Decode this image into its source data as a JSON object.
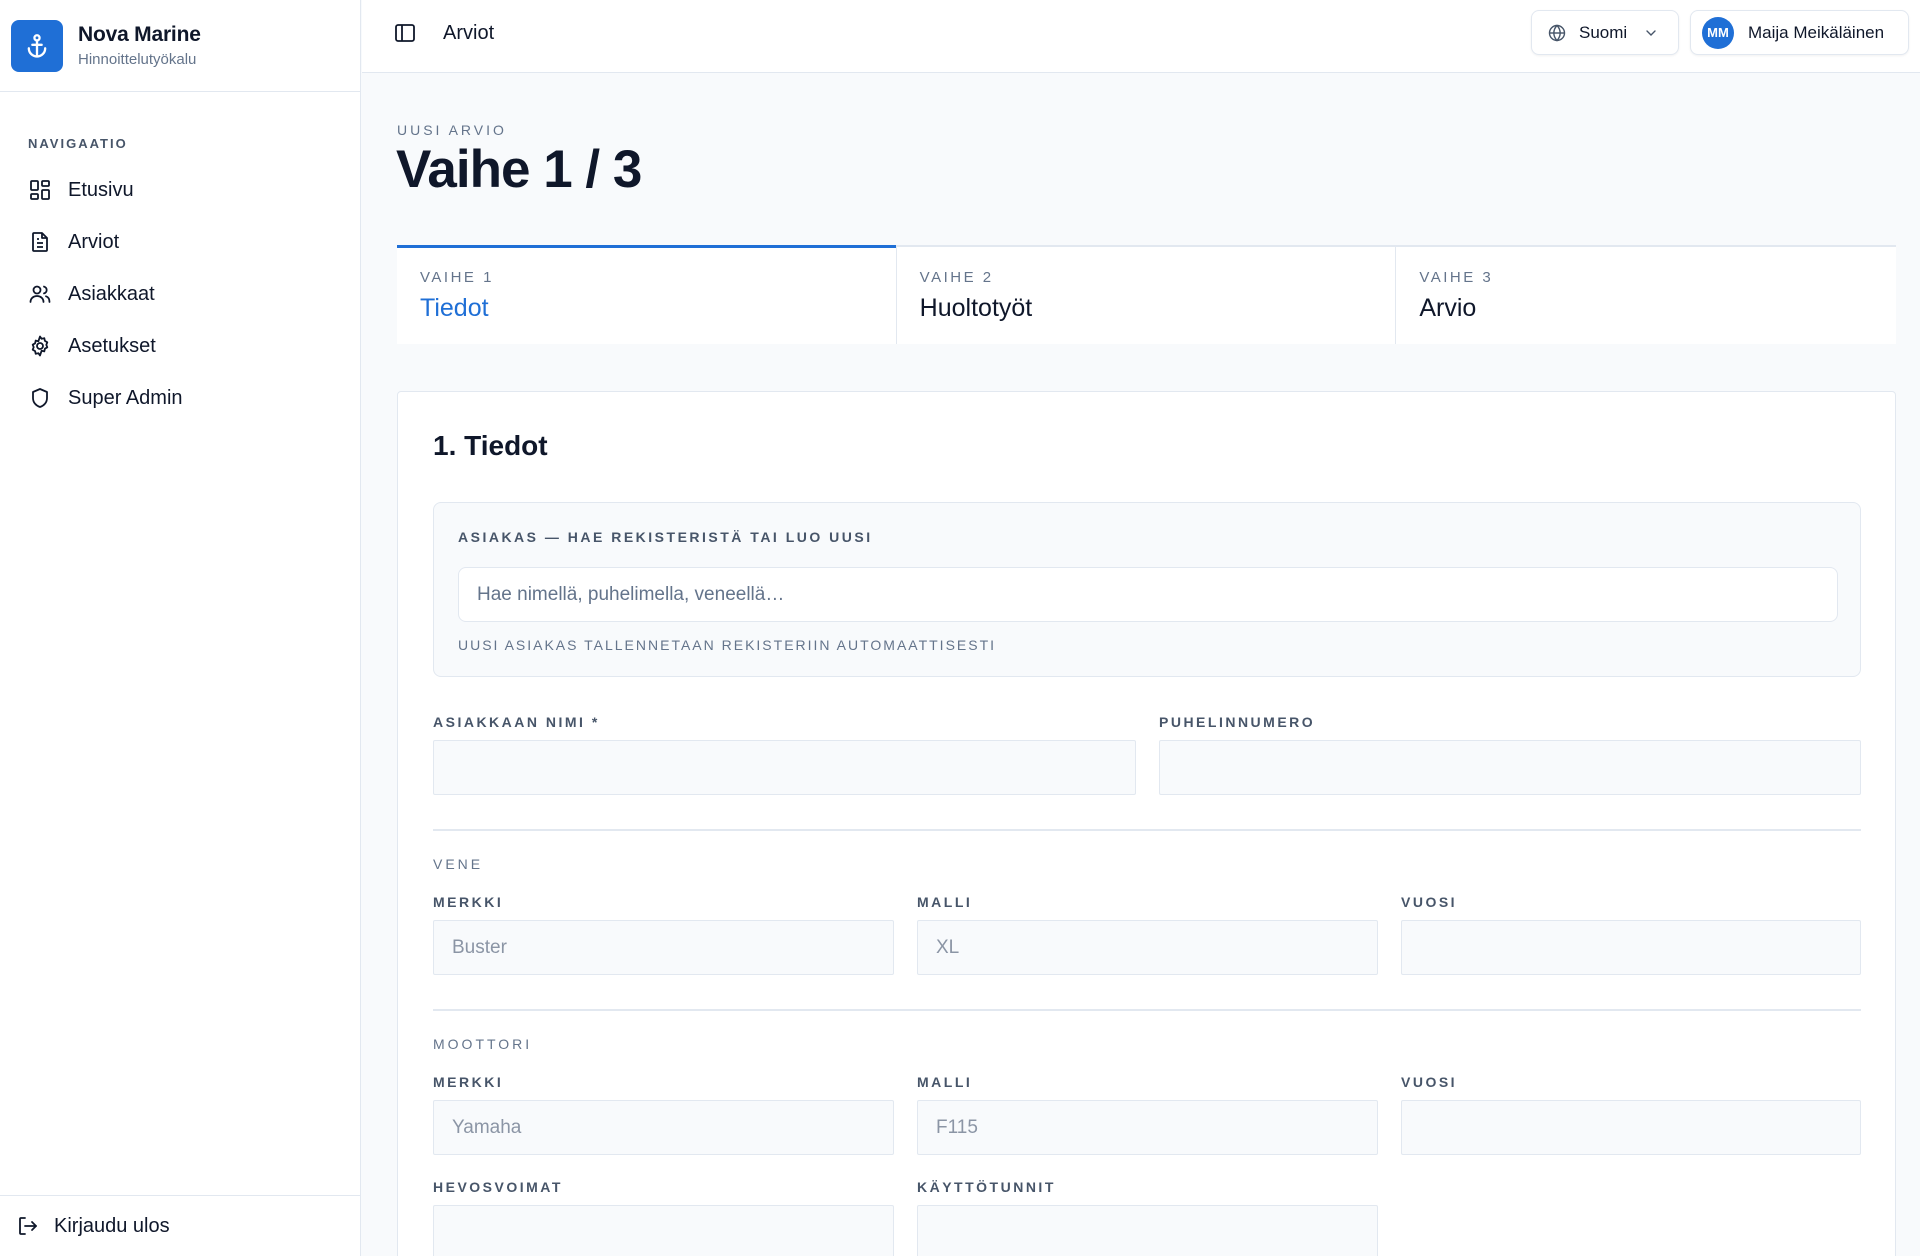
{
  "brand": {
    "name": "Nova Marine",
    "subtitle": "Hinnoittelutyökalu",
    "logo_icon": "anchor-icon"
  },
  "sidebar": {
    "nav_title": "NAVIGAATIO",
    "items": [
      {
        "label": "Etusivu",
        "icon": "dashboard-icon"
      },
      {
        "label": "Arviot",
        "icon": "document-icon"
      },
      {
        "label": "Asiakkaat",
        "icon": "users-icon"
      },
      {
        "label": "Asetukset",
        "icon": "gear-icon"
      },
      {
        "label": "Super Admin",
        "icon": "shield-icon"
      }
    ],
    "logout_label": "Kirjaudu ulos"
  },
  "topbar": {
    "title": "Arviot",
    "language": "Suomi",
    "user": {
      "initials": "MM",
      "name": "Maija Meikäläinen"
    }
  },
  "page": {
    "kicker": "UUSI ARVIO",
    "title": "Vaihe 1 / 3"
  },
  "steps": [
    {
      "label": "VAIHE 1",
      "name": "Tiedot",
      "active": true
    },
    {
      "label": "VAIHE 2",
      "name": "Huoltotyöt",
      "active": false
    },
    {
      "label": "VAIHE 3",
      "name": "Arvio",
      "active": false
    }
  ],
  "form": {
    "title": "1. Tiedot",
    "customer_search": {
      "label": "ASIAKAS — HAE REKISTERISTÄ TAI LUO UUSI",
      "placeholder": "Hae nimellä, puhelimella, veneellä…",
      "hint": "UUSI ASIAKAS TALLENNETAAN REKISTERIIN AUTOMAATTISESTI"
    },
    "customer_name": {
      "label": "ASIAKKAAN NIMI *",
      "value": ""
    },
    "phone": {
      "label": "PUHELINNUMERO",
      "value": ""
    },
    "boat": {
      "section": "VENE",
      "brand": {
        "label": "MERKKI",
        "placeholder": "Buster"
      },
      "model": {
        "label": "MALLI",
        "placeholder": "XL"
      },
      "year": {
        "label": "VUOSI",
        "placeholder": ""
      }
    },
    "engine": {
      "section": "MOOTTORI",
      "brand": {
        "label": "MERKKI",
        "placeholder": "Yamaha"
      },
      "model": {
        "label": "MALLI",
        "placeholder": "F115"
      },
      "year": {
        "label": "VUOSI",
        "placeholder": ""
      },
      "horsepower": {
        "label": "HEVOSVOIMAT",
        "placeholder": ""
      },
      "hours": {
        "label": "KÄYTTÖTUNNIT",
        "placeholder": ""
      }
    }
  },
  "colors": {
    "accent": "#1f6fd6",
    "border": "#e2e8f0",
    "text": "#0f172a",
    "muted": "#64748b"
  }
}
